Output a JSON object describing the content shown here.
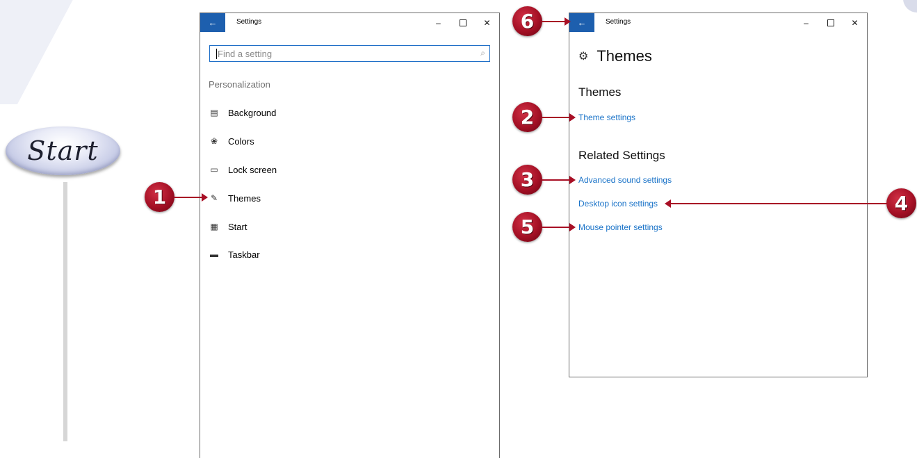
{
  "start_badge": {
    "label": "Start"
  },
  "left_window": {
    "title": "Settings",
    "back_icon": "back-arrow-icon",
    "search": {
      "placeholder": "Find a setting",
      "icon": "search-icon"
    },
    "section_label": "Personalization",
    "nav_items": [
      {
        "label": "Background",
        "icon": "picture-icon"
      },
      {
        "label": "Colors",
        "icon": "palette-icon"
      },
      {
        "label": "Lock screen",
        "icon": "lock-screen-icon"
      },
      {
        "label": "Themes",
        "icon": "themes-icon"
      },
      {
        "label": "Start",
        "icon": "start-tiles-icon"
      },
      {
        "label": "Taskbar",
        "icon": "taskbar-icon"
      }
    ]
  },
  "right_window": {
    "title": "Settings",
    "page_title": "Themes",
    "themes_heading": "Themes",
    "theme_settings_link": "Theme settings",
    "related_heading": "Related Settings",
    "related_links": [
      "Advanced sound settings",
      "Desktop icon settings",
      "Mouse pointer settings"
    ]
  },
  "window_controls": {
    "minimize": "–",
    "close": "✕"
  },
  "callouts": [
    "1",
    "2",
    "3",
    "4",
    "5",
    "6"
  ],
  "colors": {
    "accent_blue": "#1d5fae",
    "link_blue": "#1a73c8",
    "callout_red": "#a80f25"
  }
}
